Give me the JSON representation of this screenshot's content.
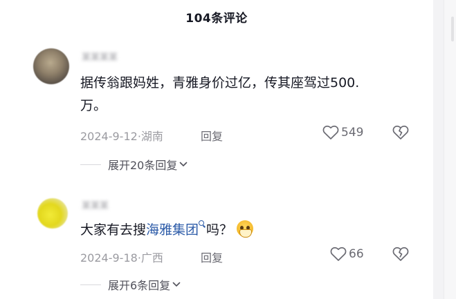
{
  "header": {
    "title": "104条评论"
  },
  "comments": [
    {
      "username": "某某某某",
      "text": "据传翁跟妈姓，青雅身价过亿，传其座驾过500.",
      "text_line2": "万。",
      "date": "2024-9-12",
      "location": "湖南",
      "reply_label": "回复",
      "likes": "549",
      "expand_label": "展开20条回复"
    },
    {
      "username": "某某某",
      "text_before": "大家有去搜",
      "link_text": "海雅集团",
      "text_after": "吗？",
      "date": "2024-9-18",
      "location": "广西",
      "reply_label": "回复",
      "likes": "66",
      "expand_label": "展开6条回复"
    }
  ],
  "icons": {
    "like": "heart-outline-icon",
    "dislike": "broken-heart-icon",
    "expand": "chevron-down-icon",
    "search": "search-icon",
    "emoji": "holding-back-tears-emoji"
  },
  "colors": {
    "text_primary": "#161823",
    "text_secondary": "#9a9aa0",
    "link": "#2c5ba8"
  }
}
